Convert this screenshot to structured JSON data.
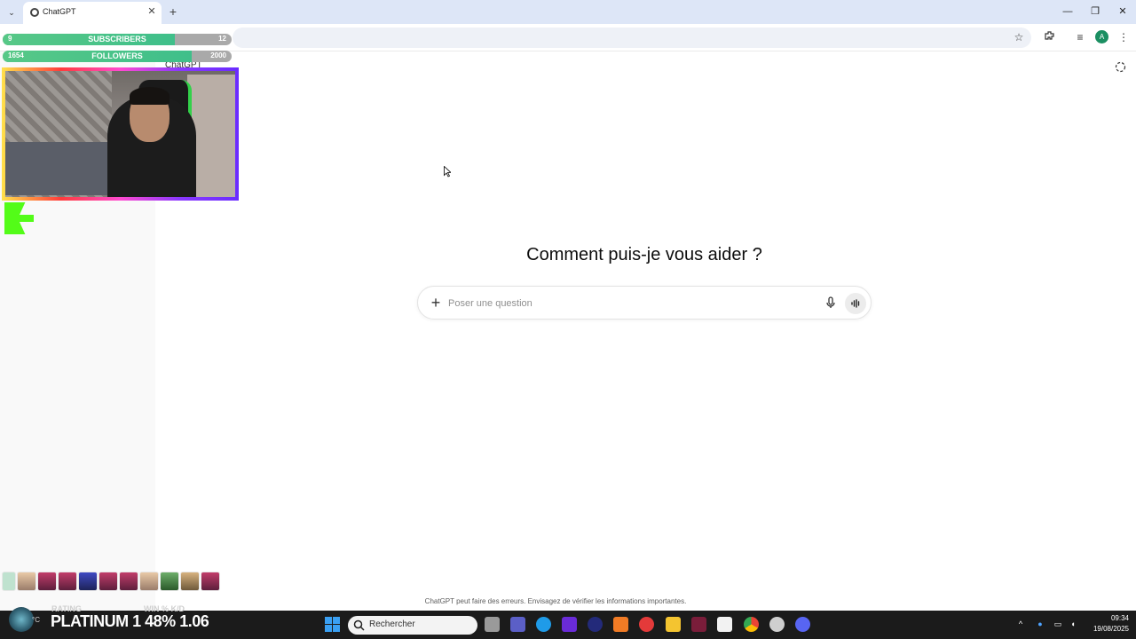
{
  "browser": {
    "tab_title": "ChatGPT",
    "tab_close": "✕",
    "new_tab": "+",
    "tab_menu": "⌄",
    "window_controls": {
      "minimize": "—",
      "maximize": "❐",
      "close": "✕"
    },
    "profile_initial": "A"
  },
  "overlay": {
    "subscribers": {
      "left": "9",
      "label": "SUBSCRIBERS",
      "right": "12",
      "progress": 0.75
    },
    "followers": {
      "left": "1654",
      "label": "FOLLOWERS",
      "right": "2000",
      "progress": 0.827
    },
    "stats": {
      "rating_label": "RATING",
      "winrate_label": "WIN % K/D",
      "value": "PLATINUM 1 48% 1.06"
    },
    "weather_temp": "°C"
  },
  "sidebar": {
    "title": "ChatGPT"
  },
  "main": {
    "heading": "Comment puis-je vous aider ?",
    "composer_placeholder": "Poser une question",
    "composer_plus": "+",
    "disclaimer": "ChatGPT peut faire des erreurs. Envisagez de vérifier les informations importantes."
  },
  "taskbar": {
    "search_placeholder": "Rechercher",
    "time": "09:34",
    "date": "19/08/2025"
  },
  "colors": {
    "tab_strip": "#dde6f7",
    "sidebar": "#f9f9f9",
    "taskbar": "#1b1b1b",
    "accent_green": "#53fc18"
  }
}
